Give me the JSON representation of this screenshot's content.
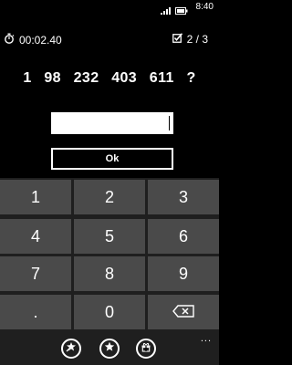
{
  "system_tray": {
    "time": "8:40",
    "icons": [
      "signal-bars-icon",
      "battery-icon"
    ]
  },
  "status": {
    "timer_icon": "stopwatch-icon",
    "timer": "00:02.40",
    "progress_icon": "checkbox-icon",
    "progress": "2 / 3"
  },
  "puzzle": {
    "sequence": "1  98  232  403  611  ?"
  },
  "answer": {
    "value": "",
    "button_label": "Ok"
  },
  "keypad": {
    "keys": [
      "1",
      "2",
      "3",
      "4",
      "5",
      "6",
      "7",
      "8",
      "9",
      ".",
      "0"
    ],
    "backspace_icon": "backspace-icon"
  },
  "app_bar": {
    "buttons": [
      "medal-star-icon",
      "star-icon",
      "gift-icon"
    ],
    "more_label": "..."
  }
}
